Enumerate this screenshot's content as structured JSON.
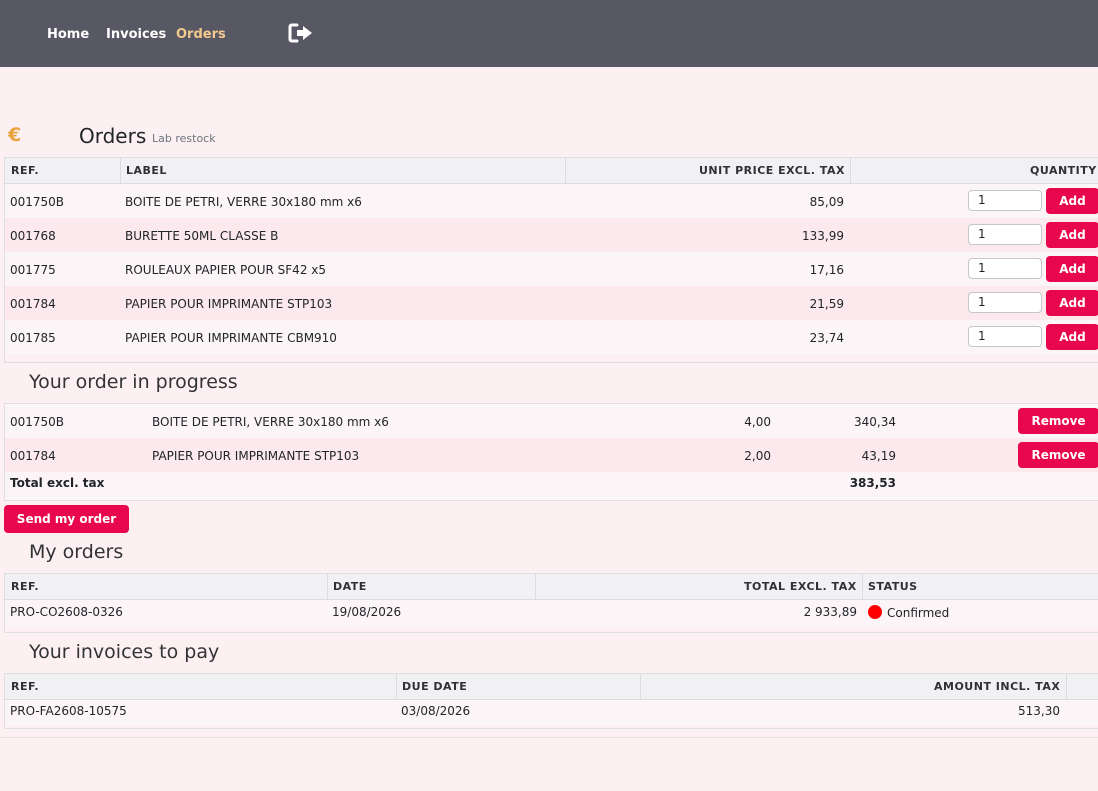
{
  "nav": {
    "home": "Home",
    "invoices": "Invoices",
    "orders": "Orders",
    "logout_icon": "sign-out-icon"
  },
  "page": {
    "icon": "€",
    "title": "Orders",
    "subtitle": "Lab restock"
  },
  "catalog": {
    "headers": {
      "ref": "REF.",
      "label": "LABEL",
      "unit_price": "UNIT PRICE EXCL. TAX",
      "quantity": "QUANTITY"
    },
    "add_label": "Add",
    "rows": [
      {
        "ref": "001750B",
        "label": "BOITE DE PETRI, VERRE 30x180 mm x6",
        "price": "85,09",
        "qty": "1"
      },
      {
        "ref": "001768",
        "label": "BURETTE 50ML CLASSE B",
        "price": "133,99",
        "qty": "1"
      },
      {
        "ref": "001775",
        "label": "ROULEAUX PAPIER POUR SF42 x5",
        "price": "17,16",
        "qty": "1"
      },
      {
        "ref": "001784",
        "label": "PAPIER POUR IMPRIMANTE STP103",
        "price": "21,59",
        "qty": "1"
      },
      {
        "ref": "001785",
        "label": "PAPIER POUR IMPRIMANTE CBM910",
        "price": "23,74",
        "qty": "1"
      }
    ]
  },
  "cart": {
    "title": "Your order in progress",
    "remove_label": "Remove",
    "rows": [
      {
        "ref": "001750B",
        "label": "BOITE DE PETRI, VERRE 30x180 mm x6",
        "qty": "4,00",
        "total": "340,34"
      },
      {
        "ref": "001784",
        "label": "PAPIER POUR IMPRIMANTE STP103",
        "qty": "2,00",
        "total": "43,19"
      }
    ],
    "total_label": "Total excl. tax",
    "total_value": "383,53",
    "send_label": "Send my order"
  },
  "my_orders": {
    "title": "My orders",
    "headers": {
      "ref": "REF.",
      "date": "DATE",
      "total": "TOTAL EXCL. TAX",
      "status": "STATUS"
    },
    "rows": [
      {
        "ref": "PRO-CO2608-0326",
        "date": "19/08/2026",
        "total": "2 933,89",
        "status": "Confirmed",
        "status_color": "#ff0000"
      }
    ]
  },
  "invoices": {
    "title": "Your invoices to pay",
    "headers": {
      "ref": "REF.",
      "due_date": "DUE DATE",
      "amount": "AMOUNT INCL. TAX"
    },
    "rows": [
      {
        "ref": "PRO-FA2608-10575",
        "due_date": "03/08/2026",
        "amount": "513,30"
      }
    ]
  },
  "colors": {
    "topbar": "#585864",
    "active_nav": "#f3c98d",
    "accent": "#e8074f",
    "background": "#fcf0f2"
  }
}
